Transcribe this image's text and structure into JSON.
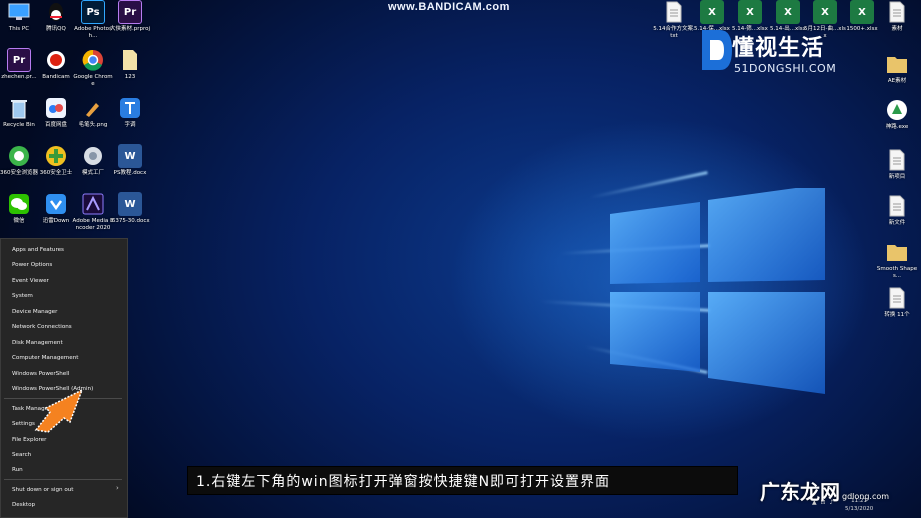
{
  "watermark": "www.BANDICAM.com",
  "desktop_icons_left": [
    {
      "name": "this-pc",
      "label": "This PC",
      "kind": "pc"
    },
    {
      "name": "tencent-qq",
      "label": "腾讯QQ",
      "kind": "qq"
    },
    {
      "name": "adobe-photoshop",
      "label": "Adobe Photosh...",
      "kind": "ps",
      "glyph": "Ps"
    },
    {
      "name": "premiere-project",
      "label": "大侠素材.prproj",
      "kind": "pr",
      "glyph": "Pr"
    },
    {
      "name": "zhechen-pr",
      "label": "zhechen.pr...",
      "kind": "pr",
      "glyph": "Pr"
    },
    {
      "name": "bandicam",
      "label": "Bandicam",
      "kind": "rec"
    },
    {
      "name": "google-chrome",
      "label": "Google Chrome",
      "kind": "chrome"
    },
    {
      "name": "file-123",
      "label": "123",
      "kind": "file"
    },
    {
      "name": "recycle-bin",
      "label": "Recycle Bin",
      "kind": "bin"
    },
    {
      "name": "baidu-netdisk",
      "label": "百度网盘",
      "kind": "cloud"
    },
    {
      "name": "pen-image",
      "label": "毛笔头.png",
      "kind": "brush"
    },
    {
      "name": "zitiao",
      "label": "字调",
      "kind": "app"
    },
    {
      "name": "360-browser",
      "label": "360安全浏览器",
      "kind": "360b"
    },
    {
      "name": "360-safe",
      "label": "360安全卫士",
      "kind": "360s"
    },
    {
      "name": "mofa-gongchang",
      "label": "模式工厂",
      "kind": "tool"
    },
    {
      "name": "ps-tutorial-docx",
      "label": "PS教程.docx",
      "kind": "wd",
      "glyph": "W"
    },
    {
      "name": "wechat",
      "label": "微信",
      "kind": "wechat"
    },
    {
      "name": "xunlei",
      "label": "迅雷Down",
      "kind": "xl"
    },
    {
      "name": "adobe-media-encoder",
      "label": "Adobe Media Encoder 2020",
      "kind": "me"
    },
    {
      "name": "docx-file",
      "label": "l6375-30.docx",
      "kind": "wd",
      "glyph": "W"
    }
  ],
  "desktop_icons_top_right": [
    {
      "name": "txt-file",
      "label": "5.14合作方文案.txt",
      "kind": "doc"
    },
    {
      "name": "xlsx-1",
      "label": "5.14-保...xlsx",
      "kind": "xls",
      "glyph": "X"
    },
    {
      "name": "xlsx-2",
      "label": "5.14-筛...xlsx",
      "kind": "xls",
      "glyph": "X"
    },
    {
      "name": "xlsx-3",
      "label": "5.14-出...xlsx",
      "kind": "xls",
      "glyph": "X"
    },
    {
      "name": "xlsx-4",
      "label": "5月12日-曲...xlsx",
      "kind": "xls",
      "glyph": "X"
    },
    {
      "name": "xlsx-5",
      "label": "1500+.xlsx",
      "kind": "xls",
      "glyph": "X"
    },
    {
      "name": "sucai",
      "label": "素材",
      "kind": "doc"
    }
  ],
  "desktop_icons_right_column": [
    {
      "name": "ae-sucai",
      "label": "AE素材",
      "kind": "fold"
    },
    {
      "name": "shenlu-exe",
      "label": "神路.exe",
      "kind": "app2"
    },
    {
      "name": "xin-xiangmu",
      "label": "新项目",
      "kind": "doc"
    },
    {
      "name": "xin-wenjian",
      "label": "新文件",
      "kind": "doc"
    },
    {
      "name": "smooth-shapes",
      "label": "Smooth Shapes...",
      "kind": "fold"
    },
    {
      "name": "zhuanhuan",
      "label": "转换 11个",
      "kind": "doc"
    }
  ],
  "context_menu": {
    "items": [
      "Apps and Features",
      "Power Options",
      "Event Viewer",
      "System",
      "Device Manager",
      "Network Connections",
      "Disk Management",
      "Computer Management",
      "Windows PowerShell",
      "Windows PowerShell (Admin)",
      "Task Manager",
      "Settings",
      "File Explorer",
      "Search",
      "Run",
      "Shut down or sign out",
      "Desktop"
    ]
  },
  "caption": "1.右键左下角的win图标打开弹窗按快捷键N即可打开设置界面",
  "logo_top": {
    "main": "懂视生活",
    "sub": "51DONGSHI.COM"
  },
  "logo_bottom": {
    "main": "广东龙网",
    "sub": "gdlong.com"
  },
  "taskbar": {
    "time": "11:21",
    "date": "5/13/2020"
  },
  "colors": {
    "menu_bg": "#262626",
    "arrow": "#f58220",
    "wallpaper": "#0c3a8c"
  }
}
